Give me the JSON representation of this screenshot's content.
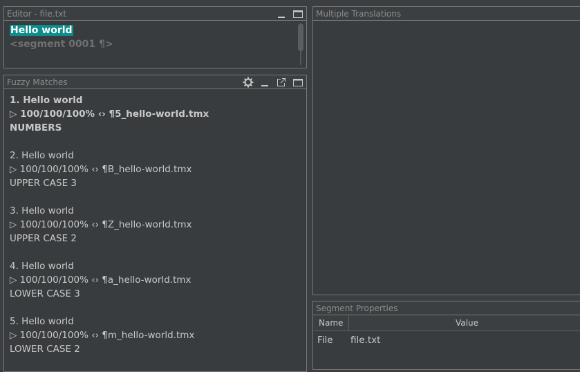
{
  "editor": {
    "title": "Editor - file.txt",
    "source_text": "Hello world",
    "segment_marker": "<segment 0001 ¶>"
  },
  "fuzzy": {
    "title": "Fuzzy Matches",
    "matches": [
      {
        "line1": "1. Hello world",
        "line2": "▷ 100/100/100% ‹› ¶5_hello-world.tmx",
        "line3": "NUMBERS"
      },
      {
        "line1": "2. Hello world",
        "line2": "▷ 100/100/100% ‹› ¶B_hello-world.tmx",
        "line3": "UPPER CASE 3"
      },
      {
        "line1": "3. Hello world",
        "line2": "▷ 100/100/100% ‹› ¶Z_hello-world.tmx",
        "line3": "UPPER CASE 2"
      },
      {
        "line1": "4. Hello world",
        "line2": "▷ 100/100/100% ‹› ¶a_hello-world.tmx",
        "line3": "LOWER CASE 3"
      },
      {
        "line1": "5. Hello world",
        "line2": "▷ 100/100/100% ‹› ¶m_hello-world.tmx",
        "line3": "LOWER CASE 2"
      }
    ]
  },
  "multi": {
    "title": "Multiple Translations"
  },
  "segprops": {
    "title": "Segment Properties",
    "col_name": "Name",
    "col_value": "Value",
    "rows": [
      {
        "name": "File",
        "value": "file.txt"
      }
    ]
  },
  "colors": {
    "highlight": "#0c8c8c",
    "background": "#3c3f41"
  }
}
